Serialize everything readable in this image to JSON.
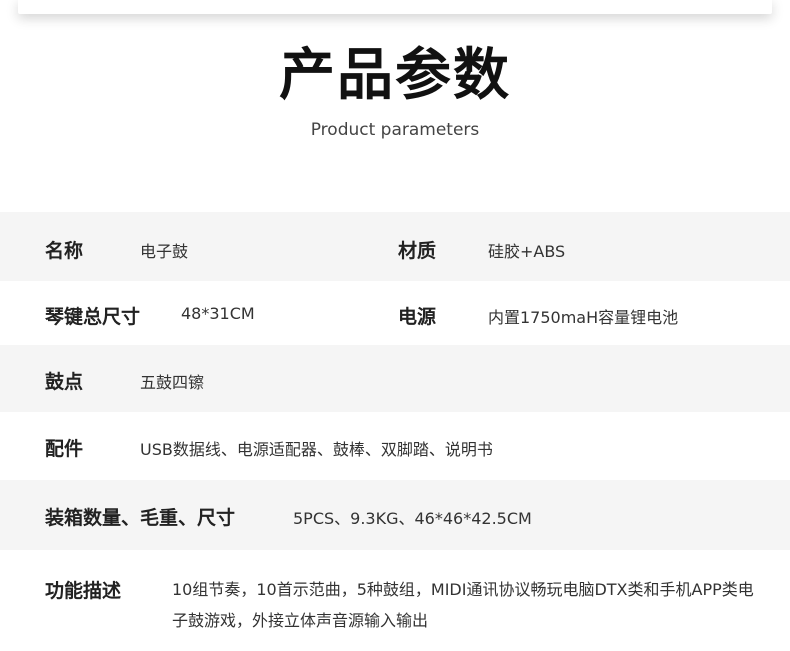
{
  "header": {
    "title": "产品参数",
    "subtitle": "Product parameters"
  },
  "rows": [
    {
      "label": "名称",
      "value": "电子鼓",
      "label2": "材质",
      "value2": "硅胶+ABS"
    },
    {
      "label": "琴键总尺寸",
      "value": "48*31CM",
      "label2": "电源",
      "value2": "内置1750maH容量锂电池"
    },
    {
      "label": "鼓点",
      "value": "五鼓四镲"
    },
    {
      "label": "配件",
      "value": "USB数据线、电源适配器、鼓棒、双脚踏、说明书"
    },
    {
      "label": "装箱数量、毛重、尺寸",
      "value": "5PCS、9.3KG、46*46*42.5CM"
    },
    {
      "label": "功能描述",
      "value": "10组节奏，10首示范曲，5种鼓组，MIDI通讯协议畅玩电脑DTX类和手机APP类电子鼓游戏，外接立体声音源输入输出"
    }
  ]
}
